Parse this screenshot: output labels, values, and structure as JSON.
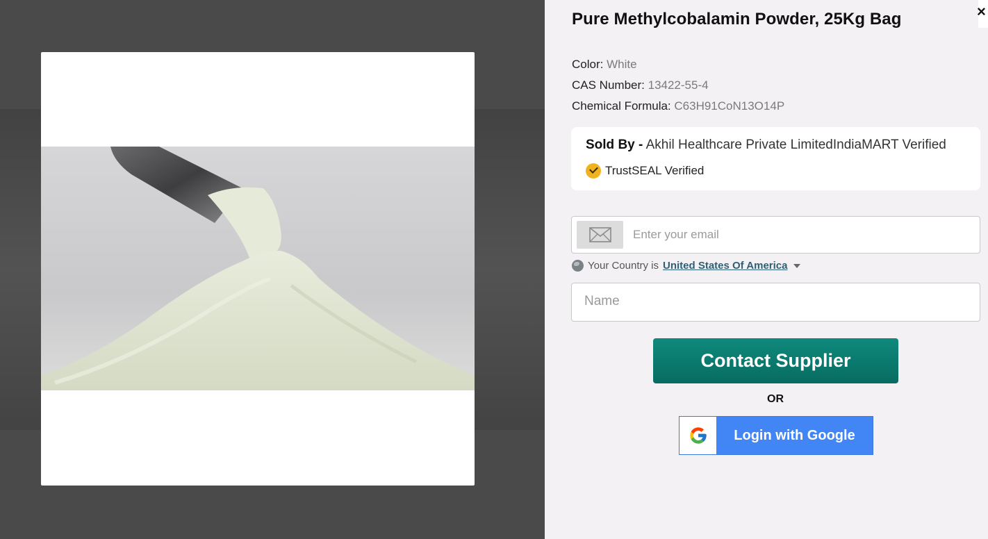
{
  "product": {
    "title": "Pure Methylcobalamin Powder, 25Kg Bag",
    "image_alt": "White powder pouring from a metal scoop"
  },
  "specs": [
    {
      "label": "Color:",
      "value": "White"
    },
    {
      "label": "CAS Number:",
      "value": "13422-55-4"
    },
    {
      "label": "Chemical Formula:",
      "value": "C63H91CoN13O14P"
    }
  ],
  "seller": {
    "sold_by_label": "Sold By -",
    "name": "Akhil Healthcare Private LimitedIndiaMART Verified",
    "trust_label": "TrustSEAL Verified"
  },
  "form": {
    "email_placeholder": "Enter your email",
    "country_prefix": "Your Country is",
    "country": "United States Of America",
    "name_placeholder": "Name"
  },
  "actions": {
    "contact_label": "Contact Supplier",
    "or_label": "OR",
    "google_label": "Login with Google",
    "close_label": "×"
  },
  "colors": {
    "contact_button": "#0e8a7c",
    "google_button": "#4285f4",
    "overlay": "#4a4a4a"
  }
}
